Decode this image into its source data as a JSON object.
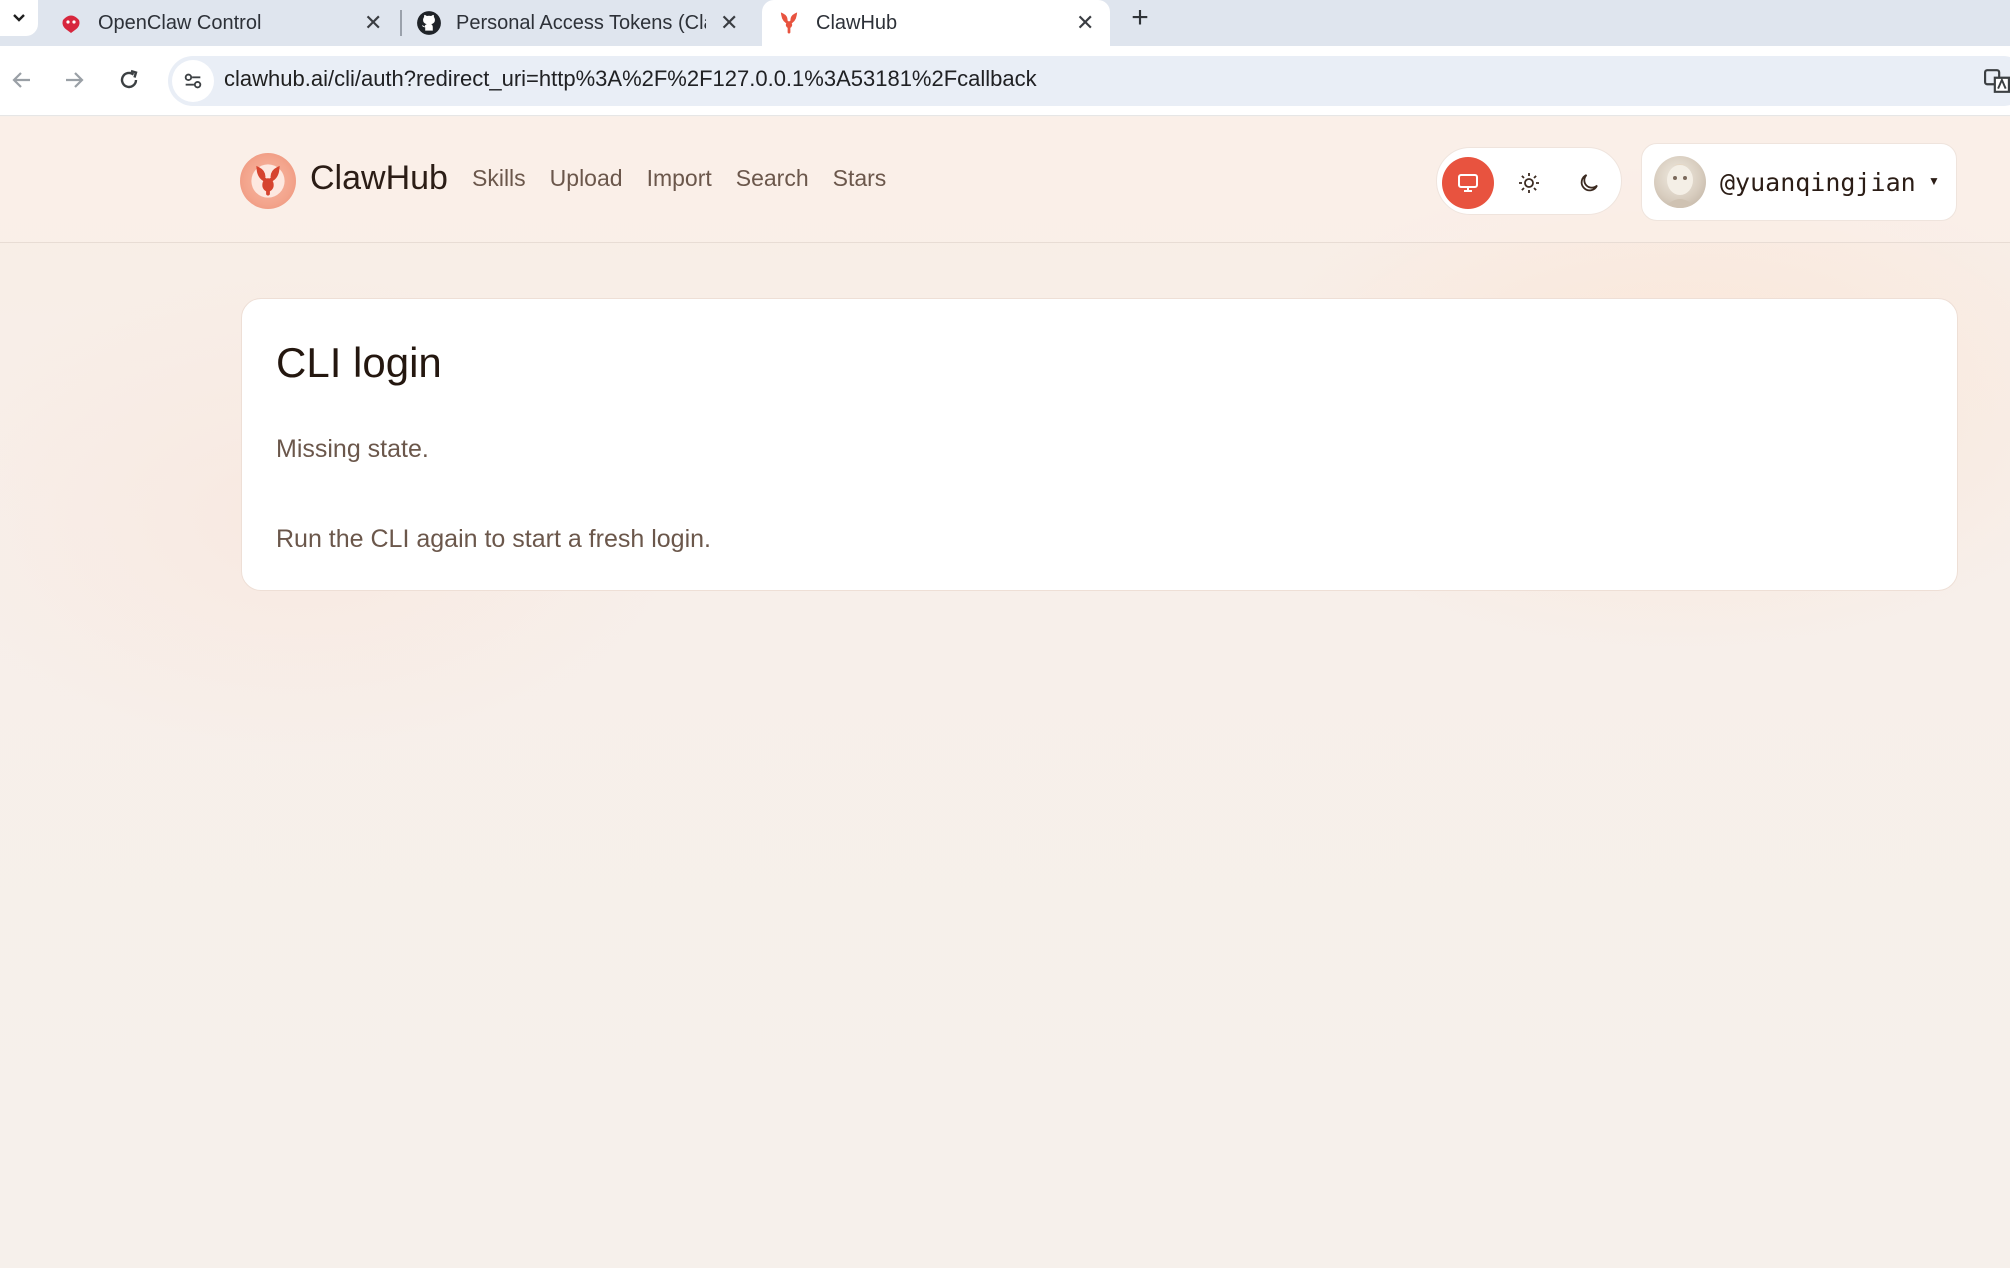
{
  "browser": {
    "tabs": [
      {
        "title": "OpenClaw Control",
        "icon": "openclaw-logo-icon"
      },
      {
        "title": "Personal Access Tokens (Clas",
        "icon": "github-icon"
      },
      {
        "title": "ClawHub",
        "icon": "clawhub-logo-icon",
        "active": true
      }
    ],
    "url_host": "clawhub.ai",
    "url_rest": "/cli/auth?redirect_uri=http%3A%2F%2F127.0.0.1%3A53181%2Fcallback"
  },
  "header": {
    "brand": "ClawHub",
    "nav": [
      "Skills",
      "Upload",
      "Import",
      "Search",
      "Stars"
    ],
    "theme_modes": [
      "system",
      "light",
      "dark"
    ],
    "active_theme": "system",
    "username": "@yuanqingjian"
  },
  "card": {
    "title": "CLI login",
    "message": "Missing state.",
    "hint": "Run the CLI again to start a fresh login."
  },
  "colors": {
    "accent": "#e8533f",
    "text_primary": "#24170f",
    "text_muted": "#6b574b"
  }
}
